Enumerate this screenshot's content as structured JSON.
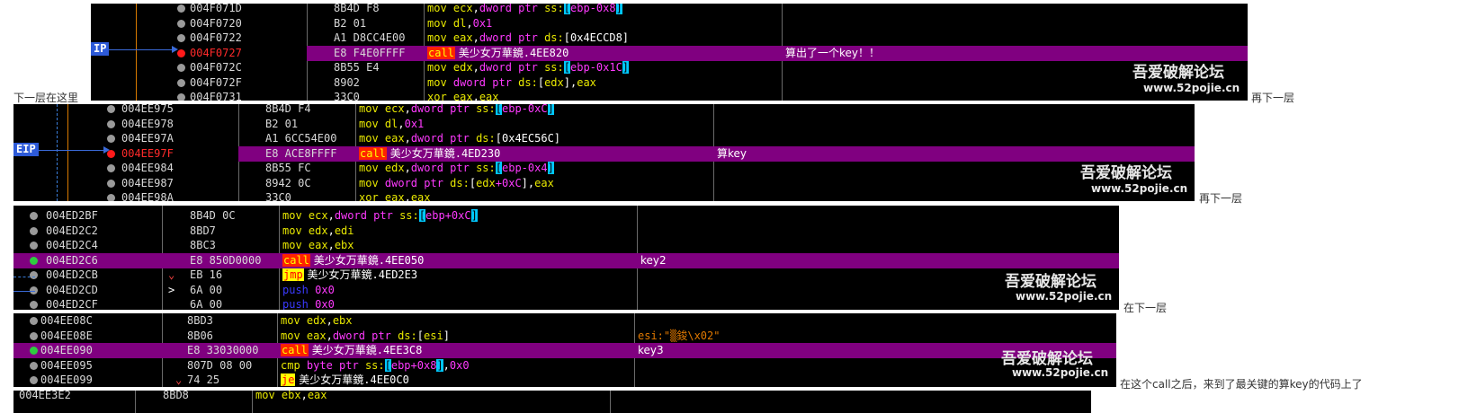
{
  "panels": [
    {
      "id": "p1",
      "ip_label": "IP",
      "rows": [
        {
          "addr": "004F071D",
          "hex": "8B4D F8",
          "asm": [
            [
              "m",
              "mov "
            ],
            [
              "r",
              "ecx"
            ],
            [
              "w",
              ","
            ],
            [
              "k",
              "dword ptr "
            ],
            [
              "s",
              "ss:"
            ],
            [
              "cyanb",
              "["
            ],
            [
              "n",
              "ebp-0x8"
            ],
            [
              "cyanb",
              "]"
            ]
          ],
          "cmt": ""
        },
        {
          "addr": "004F0720",
          "hex": "B2 01",
          "asm": [
            [
              "m",
              "mov "
            ],
            [
              "r",
              "dl"
            ],
            [
              "w",
              ","
            ],
            [
              "n",
              "0x1"
            ]
          ],
          "cmt": ""
        },
        {
          "addr": "004F0722",
          "hex": "A1 D8CC4E00",
          "asm": [
            [
              "m",
              "mov "
            ],
            [
              "r",
              "eax"
            ],
            [
              "w",
              ","
            ],
            [
              "k",
              "dword ptr "
            ],
            [
              "s",
              "ds:"
            ],
            [
              "w",
              "[0x4ECCD8]"
            ]
          ],
          "cmt": ""
        },
        {
          "addr": "004F0727",
          "hex": "E8 F4E0FFFF",
          "asm": [
            [
              "callb",
              "call"
            ],
            [
              "cjk",
              " 美少女万華鏡"
            ],
            [
              "w",
              ".4EE820"
            ]
          ],
          "cmt": "算出了一个key！！",
          "current": true
        },
        {
          "addr": "004F072C",
          "hex": "8B55 E4",
          "asm": [
            [
              "m",
              "mov "
            ],
            [
              "r",
              "edx"
            ],
            [
              "w",
              ","
            ],
            [
              "k",
              "dword ptr "
            ],
            [
              "s",
              "ss:"
            ],
            [
              "cyanb",
              "["
            ],
            [
              "n",
              "ebp-0x1C"
            ],
            [
              "cyanb",
              "]"
            ]
          ],
          "cmt": ""
        },
        {
          "addr": "004F072F",
          "hex": "8902",
          "asm": [
            [
              "m",
              "mov "
            ],
            [
              "k",
              "dword ptr "
            ],
            [
              "s",
              "ds:"
            ],
            [
              "w",
              "["
            ],
            [
              "r",
              "edx"
            ],
            [
              "w",
              "]"
            ],
            [
              "w",
              ","
            ],
            [
              "r",
              "eax"
            ]
          ],
          "cmt": ""
        },
        {
          "addr": "004F0731",
          "hex": "33C0",
          "asm": [
            [
              "m",
              "xor "
            ],
            [
              "r",
              "eax"
            ],
            [
              "w",
              ","
            ],
            [
              "r",
              "eax"
            ]
          ],
          "cmt": ""
        }
      ]
    },
    {
      "id": "p2",
      "ip_label": "EIP",
      "rows": [
        {
          "addr": "004EE975",
          "hex": "8B4D F4",
          "asm": [
            [
              "m",
              "mov "
            ],
            [
              "r",
              "ecx"
            ],
            [
              "w",
              ","
            ],
            [
              "k",
              "dword ptr "
            ],
            [
              "s",
              "ss:"
            ],
            [
              "cyanb",
              "["
            ],
            [
              "n",
              "ebp-0xC"
            ],
            [
              "cyanb",
              "]"
            ]
          ],
          "cmt": ""
        },
        {
          "addr": "004EE978",
          "hex": "B2 01",
          "asm": [
            [
              "m",
              "mov "
            ],
            [
              "r",
              "dl"
            ],
            [
              "w",
              ","
            ],
            [
              "n",
              "0x1"
            ]
          ],
          "cmt": ""
        },
        {
          "addr": "004EE97A",
          "hex": "A1 6CC54E00",
          "asm": [
            [
              "m",
              "mov "
            ],
            [
              "r",
              "eax"
            ],
            [
              "w",
              ","
            ],
            [
              "k",
              "dword ptr "
            ],
            [
              "s",
              "ds:"
            ],
            [
              "w",
              "[0x4EC56C]"
            ]
          ],
          "cmt": ""
        },
        {
          "addr": "004EE97F",
          "hex": "E8 ACE8FFFF",
          "asm": [
            [
              "callb",
              "call"
            ],
            [
              "cjk",
              " 美少女万華鏡"
            ],
            [
              "w",
              ".4ED230"
            ]
          ],
          "cmt": "算key",
          "current": true
        },
        {
          "addr": "004EE984",
          "hex": "8B55 FC",
          "asm": [
            [
              "m",
              "mov "
            ],
            [
              "r",
              "edx"
            ],
            [
              "w",
              ","
            ],
            [
              "k",
              "dword ptr "
            ],
            [
              "s",
              "ss:"
            ],
            [
              "cyanb",
              "["
            ],
            [
              "n",
              "ebp-0x4"
            ],
            [
              "cyanb",
              "]"
            ]
          ],
          "cmt": ""
        },
        {
          "addr": "004EE987",
          "hex": "8942 0C",
          "asm": [
            [
              "m",
              "mov "
            ],
            [
              "k",
              "dword ptr "
            ],
            [
              "s",
              "ds:"
            ],
            [
              "w",
              "["
            ],
            [
              "r",
              "edx"
            ],
            [
              "n",
              "+0xC"
            ],
            [
              "w",
              "]"
            ],
            [
              "w",
              ","
            ],
            [
              "r",
              "eax"
            ]
          ],
          "cmt": ""
        },
        {
          "addr": "004EE98A",
          "hex": "33C0",
          "asm": [
            [
              "m",
              "xor "
            ],
            [
              "r",
              "eax"
            ],
            [
              "w",
              ","
            ],
            [
              "r",
              "eax"
            ]
          ],
          "cmt": ""
        }
      ]
    },
    {
      "id": "p3",
      "rows": [
        {
          "addr": "004ED2BF",
          "hex": "8B4D 0C",
          "asm": [
            [
              "m",
              "mov "
            ],
            [
              "r",
              "ecx"
            ],
            [
              "w",
              ","
            ],
            [
              "k",
              "dword ptr "
            ],
            [
              "s",
              "ss:"
            ],
            [
              "cyanb",
              "["
            ],
            [
              "n",
              "ebp+0xC"
            ],
            [
              "cyanb",
              "]"
            ]
          ],
          "cmt": ""
        },
        {
          "addr": "004ED2C2",
          "hex": "8BD7",
          "asm": [
            [
              "m",
              "mov "
            ],
            [
              "r",
              "edx"
            ],
            [
              "w",
              ","
            ],
            [
              "r",
              "edi"
            ]
          ],
          "cmt": ""
        },
        {
          "addr": "004ED2C4",
          "hex": "8BC3",
          "asm": [
            [
              "m",
              "mov "
            ],
            [
              "r",
              "eax"
            ],
            [
              "w",
              ","
            ],
            [
              "r",
              "ebx"
            ]
          ],
          "cmt": ""
        },
        {
          "addr": "004ED2C6",
          "hex": "E8 850D0000",
          "asm": [
            [
              "callb",
              "call"
            ],
            [
              "cjk",
              " 美少女万華鏡"
            ],
            [
              "w",
              ".4EE050"
            ]
          ],
          "cmt": "key2",
          "current": true
        },
        {
          "addr": "004ED2CB",
          "hex": "EB 16",
          "asm": [
            [
              "jmpb",
              "jmp"
            ],
            [
              "cjk",
              " 美少女万華鏡"
            ],
            [
              "w",
              ".4ED2E3"
            ]
          ],
          "cmt": "",
          "mark": "⌄"
        },
        {
          "addr": "004ED2CD",
          "hex": "6A 00",
          "asm": [
            [
              "pushc",
              "push "
            ],
            [
              "n",
              "0x0"
            ]
          ],
          "cmt": "",
          "mark": ">"
        },
        {
          "addr": "004ED2CF",
          "hex": "6A 00",
          "asm": [
            [
              "pushc",
              "push "
            ],
            [
              "n",
              "0x0"
            ]
          ],
          "cmt": ""
        }
      ]
    },
    {
      "id": "p4",
      "rows": [
        {
          "addr": "004EE08C",
          "hex": "8BD3",
          "asm": [
            [
              "m",
              "mov "
            ],
            [
              "r",
              "edx"
            ],
            [
              "w",
              ","
            ],
            [
              "r",
              "ebx"
            ]
          ],
          "cmt": ""
        },
        {
          "addr": "004EE08E",
          "hex": "8B06",
          "asm": [
            [
              "m",
              "mov "
            ],
            [
              "r",
              "eax"
            ],
            [
              "w",
              ","
            ],
            [
              "k",
              "dword ptr "
            ],
            [
              "s",
              "ds:"
            ],
            [
              "w",
              "["
            ],
            [
              "r",
              "esi"
            ],
            [
              "w",
              "]"
            ]
          ],
          "cmt": "esi:\"▒鋑\\x02\"",
          "cmt_orange": true
        },
        {
          "addr": "004EE090",
          "hex": "E8 33030000",
          "asm": [
            [
              "callb",
              "call"
            ],
            [
              "cjk",
              " 美少女万華鏡"
            ],
            [
              "w",
              ".4EE3C8"
            ]
          ],
          "cmt": "key3",
          "current": true
        },
        {
          "addr": "004EE095",
          "hex": "807D 08 00",
          "asm": [
            [
              "m",
              "cmp "
            ],
            [
              "k",
              "byte ptr "
            ],
            [
              "s",
              "ss:"
            ],
            [
              "cyanb",
              "["
            ],
            [
              "n",
              "ebp+0x8"
            ],
            [
              "cyanb",
              "]"
            ],
            [
              "w",
              ","
            ],
            [
              "n",
              "0x0"
            ]
          ],
          "cmt": ""
        },
        {
          "addr": "004EE099",
          "hex": "74 25",
          "asm": [
            [
              "jmpb",
              "je"
            ],
            [
              "cjk",
              " 美少女万華鏡"
            ],
            [
              "w",
              ".4EE0C0"
            ]
          ],
          "cmt": "",
          "mark": "⌄"
        }
      ]
    },
    {
      "id": "p5",
      "rows": [
        {
          "addr": "004EE3E2",
          "hex": "8BD8",
          "asm": [
            [
              "m",
              "mov "
            ],
            [
              "r",
              "ebx"
            ],
            [
              "w",
              ","
            ],
            [
              "r",
              "eax"
            ]
          ],
          "cmt": ""
        }
      ]
    }
  ],
  "watermark": {
    "line1": "吾爱破解论坛",
    "line2": "www.52pojie.cn"
  },
  "notes": {
    "n1": "下一层在这里",
    "n2": "再下一层",
    "n3": "再下一层",
    "n4": "在下一层",
    "n5": "在这个call之后，来到了最关键的算key的代码上了"
  }
}
